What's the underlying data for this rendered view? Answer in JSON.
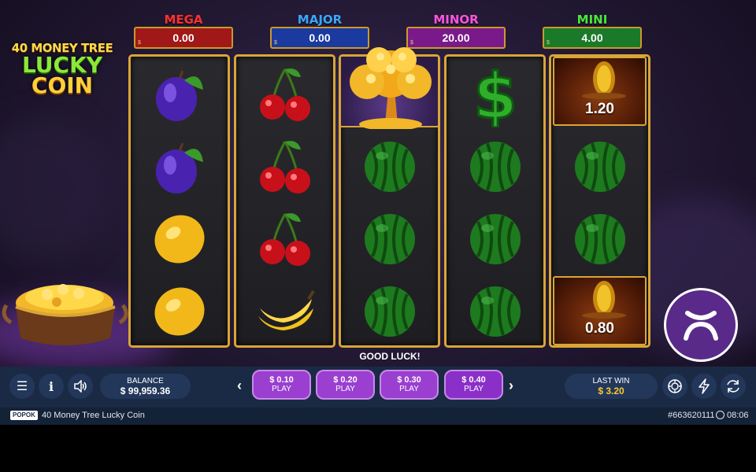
{
  "logo": {
    "line1": "40 MONEY TREE",
    "line2": "LUCKY",
    "line3": "COIN"
  },
  "jackpots": [
    {
      "name": "MEGA",
      "value": "0.00",
      "color": "#ff3030",
      "bg": "#a01818"
    },
    {
      "name": "MAJOR",
      "value": "0.00",
      "color": "#3aa8ff",
      "bg": "#1a3aa0"
    },
    {
      "name": "MINOR",
      "value": "20.00",
      "color": "#ff55e0",
      "bg": "#7a1a8a"
    },
    {
      "name": "MINI",
      "value": "4.00",
      "color": "#4ae83a",
      "bg": "#1a7a2a"
    }
  ],
  "jackpot_currency": "$",
  "reels": [
    [
      "plum",
      "plum",
      "lemon",
      "lemon"
    ],
    [
      "cherry",
      "cherry",
      "cherry",
      "banana"
    ],
    [
      "money-tree",
      "watermelon",
      "watermelon",
      "watermelon"
    ],
    [
      "dollar",
      "watermelon",
      "watermelon",
      "watermelon"
    ],
    [
      "coin",
      "watermelon",
      "watermelon",
      "coin"
    ]
  ],
  "coin_values": {
    "r0": "1.20",
    "r3": "0.80"
  },
  "status_message": "GOOD LUCK!",
  "balance": {
    "label": "BALANCE",
    "value": "$ 99,959.36"
  },
  "bets": [
    {
      "amount": "$ 0.10",
      "label": "PLAY"
    },
    {
      "amount": "$ 0.20",
      "label": "PLAY"
    },
    {
      "amount": "$ 0.30",
      "label": "PLAY"
    },
    {
      "amount": "$ 0.40",
      "label": "PLAY"
    }
  ],
  "last_win": {
    "label": "LAST WIN",
    "value": "$ 3.20",
    "color": "#ffc933"
  },
  "footer": {
    "provider": "POPOK",
    "game_title": "40 Money Tree Lucky Coin",
    "round_id": "#663620111",
    "time": "08:06"
  }
}
